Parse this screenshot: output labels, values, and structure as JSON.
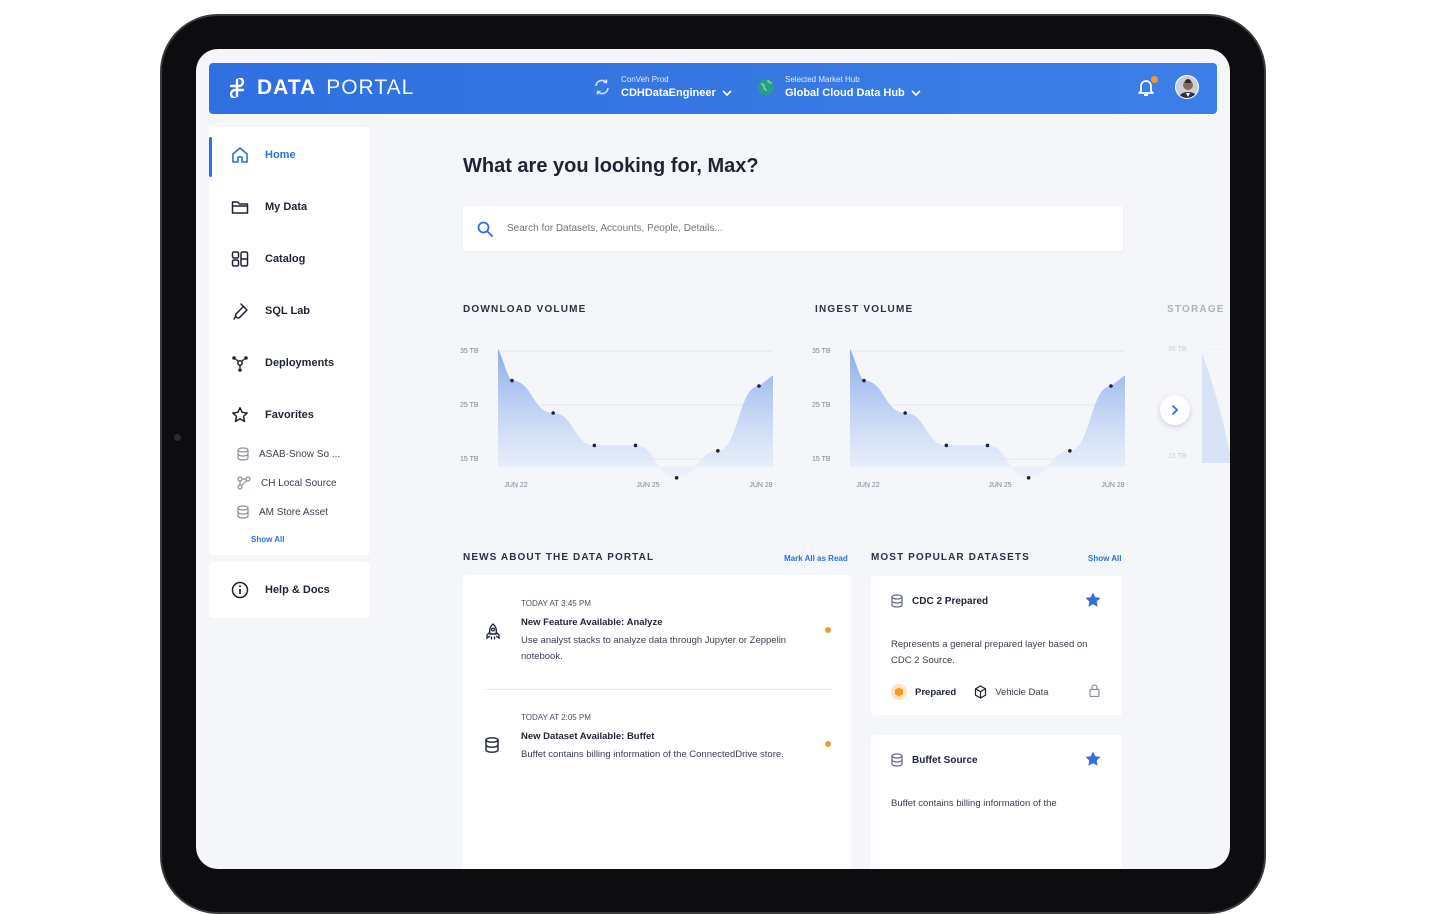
{
  "brand": {
    "bold": "DATA",
    "light": "PORTAL"
  },
  "context": [
    {
      "label": "ConVeh Prod",
      "value": "CDHDataEngineer"
    },
    {
      "label": "Selected Market Hub",
      "value": "Global Cloud Data Hub"
    }
  ],
  "sidebar": {
    "items": [
      {
        "label": "Home",
        "icon": "home-icon"
      },
      {
        "label": "My Data",
        "icon": "folder-icon"
      },
      {
        "label": "Catalog",
        "icon": "catalog-icon"
      },
      {
        "label": "SQL Lab",
        "icon": "flask-icon"
      },
      {
        "label": "Deployments",
        "icon": "network-icon"
      },
      {
        "label": "Favorites",
        "icon": "star-icon"
      }
    ],
    "favorites": [
      {
        "label": "ASAB-Snow So ...",
        "icon": "database-icon"
      },
      {
        "label": "CH Local Source",
        "icon": "source-icon"
      },
      {
        "label": "AM Store Asset",
        "icon": "database-icon"
      }
    ],
    "show_all": "Show All",
    "help": "Help & Docs"
  },
  "main": {
    "greeting": "What are you looking for, Max?",
    "search_placeholder": "Search for Datasets, Accounts, People, Details..."
  },
  "charts": [
    {
      "title": "DOWNLOAD VOLUME"
    },
    {
      "title": "INGEST VOLUME"
    },
    {
      "title": "STORAGE"
    }
  ],
  "chart_axis": {
    "y_ticks": [
      "35 TB",
      "25 TB",
      "15 TB"
    ],
    "x_ticks": [
      "JUN 22",
      "JUN 25",
      "JUN 28"
    ]
  },
  "chart_data": [
    {
      "type": "area",
      "title": "DOWNLOAD VOLUME",
      "ylim": [
        15,
        35
      ],
      "x": [
        "JUN 22",
        "",
        "",
        "JUN 25",
        "",
        "",
        "JUN 28"
      ],
      "values": [
        31,
        25,
        19,
        19,
        13,
        18,
        30
      ]
    },
    {
      "type": "area",
      "title": "INGEST VOLUME",
      "ylim": [
        15,
        35
      ],
      "x": [
        "JUN 22",
        "",
        "",
        "JUN 25",
        "",
        "",
        "JUN 28"
      ],
      "values": [
        31,
        25,
        19,
        19,
        13,
        18,
        30
      ]
    }
  ],
  "news": {
    "title": "NEWS ABOUT THE DATA PORTAL",
    "link": "Mark All as Read",
    "items": [
      {
        "time": "TODAY AT 3:45 PM",
        "title": "New Feature Available: Analyze",
        "desc": "Use analyst stacks to analyze data through Jupyter or Zeppelin notebook.",
        "icon": "rocket-icon"
      },
      {
        "time": "TODAY AT 2:05 PM",
        "title": "New Dataset Available: Buffet",
        "desc": "Buffet contains billing information of the ConnectedDrive store.",
        "icon": "database-icon"
      }
    ]
  },
  "popular": {
    "title": "MOST POPULAR DATASETS",
    "link": "Show All",
    "cards": [
      {
        "name": "CDC 2 Prepared",
        "desc": "Represents a general prepared layer based on CDC 2 Source.",
        "tag1": "Prepared",
        "tag2": "Vehicle Data"
      },
      {
        "name": "Buffet Source",
        "desc": "Buffet contains billing information of the"
      }
    ]
  },
  "colors": {
    "accent": "#2f6fe0",
    "notification": "#f59a23"
  }
}
